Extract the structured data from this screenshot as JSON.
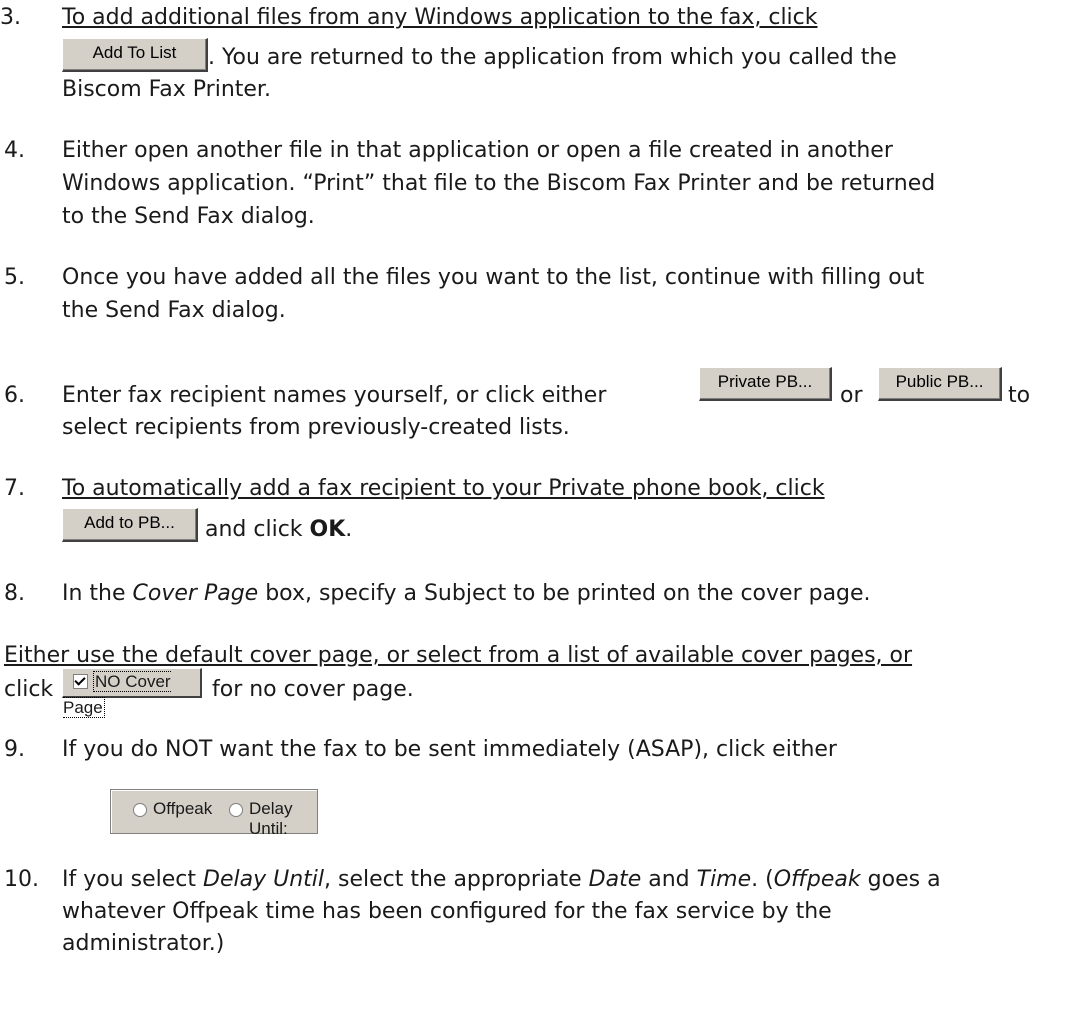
{
  "step3": {
    "num": "3.",
    "line1": "To add additional files from any Windows application to the fax, click",
    "button": "Add To List",
    "line2": ". You are returned to the application from which you called the",
    "line3": "Biscom Fax Printer."
  },
  "step4": {
    "num": "4.",
    "line1": "Either open another file in that application or open a file created in another",
    "line2": "Windows application.  “Print” that file to the Biscom Fax Printer and be returned",
    "line3": "to the Send Fax dialog."
  },
  "step5": {
    "num": "5.",
    "line1": "Once you have added all the files you want to the list, continue with filling out",
    "line2": "the Send Fax dialog."
  },
  "step6": {
    "num": "6.",
    "line1a": "Enter fax recipient names yourself, or click either",
    "button1": "Private PB...",
    "or": "or",
    "button2": "Public PB...",
    "to": "to",
    "line2": "select recipients from previously-created lists."
  },
  "step7": {
    "num": "7.",
    "line1": "To automatically add a fax recipient to your Private phone book, click",
    "button": "Add to PB...",
    "line2a": "and click ",
    "ok": "OK",
    "line2b": "."
  },
  "step8": {
    "num": "8.",
    "pre": "In the ",
    "em": "Cover Page",
    "post": " box, specify a Subject to be printed on the cover page."
  },
  "para": {
    "line1": "Either use the default cover page, or select from a list of available cover pages, or",
    "click": "click",
    "checkbox": "NO Cover Page",
    "line2": "for no cover page."
  },
  "step9": {
    "num": "9.",
    "line1": "If you do NOT want the fax to be sent immediately (ASAP), click either",
    "radio1": "Offpeak",
    "radio2": "Delay Until:"
  },
  "step10": {
    "num": "10.",
    "pre": "If you select ",
    "em1": "Delay Until",
    "mid1": ", select the appropriate ",
    "em2": "Date",
    "mid2": " and ",
    "em3": "Time",
    "mid3": ".  (",
    "em4": "Offpeak",
    "post": " goes a",
    "line2": "whatever Offpeak time has been configured for the fax service by the",
    "line3": "administrator.)"
  }
}
